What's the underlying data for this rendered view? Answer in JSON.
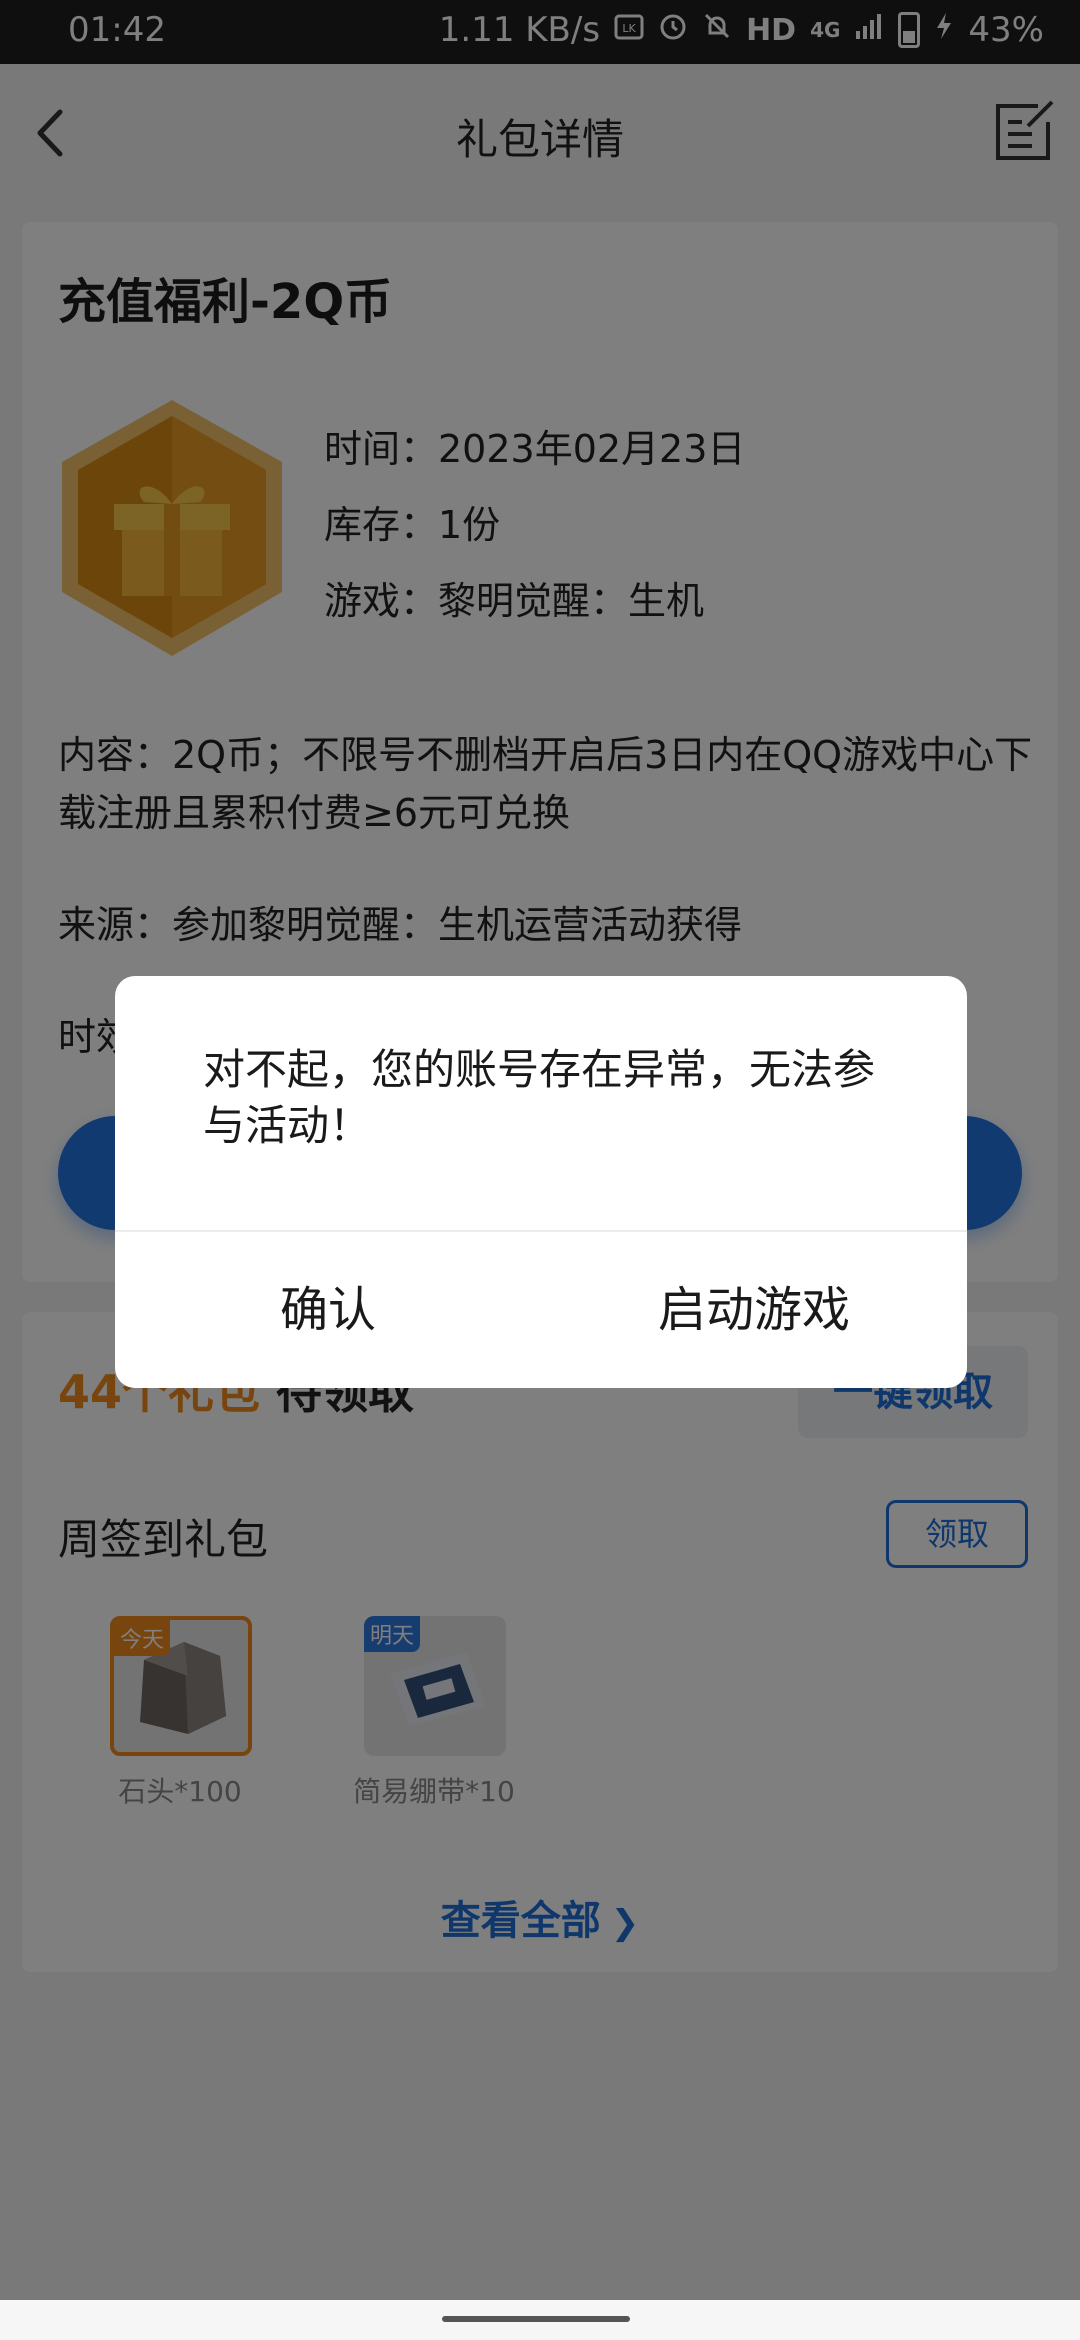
{
  "status_bar": {
    "time": "01:42",
    "net_speed": "1.11 KB/s",
    "hd": "HD",
    "network": "4G",
    "battery": "43%"
  },
  "header": {
    "title": "礼包详情"
  },
  "gift": {
    "title": "充值福利-2Q币",
    "time": "时间：2023年02月23日",
    "stock": "库存：1份",
    "game": "游戏：黎明觉醒：生机",
    "content": "内容：2Q币；不限号不删档开启后3日内在QQ游戏中心下载注册且累积付费≥6元可兑换",
    "source": "来源：参加黎明觉醒：生机运营活动获得",
    "valid_prefix": "时效"
  },
  "gifts_section": {
    "pending_count": "44个礼包",
    "pending_suffix": "待领取",
    "one_click_label": "一键领取",
    "weekly_title": "周签到礼包",
    "receive_label": "领取",
    "rewards": [
      {
        "tag": "今天",
        "name": "石头*100"
      },
      {
        "tag": "明天",
        "name": "简易绷带*10"
      }
    ],
    "view_all_label": "查看全部"
  },
  "dialog": {
    "message": "对不起，您的账号存在异常，无法参与活动！",
    "confirm_label": "确认",
    "launch_label": "启动游戏"
  },
  "colors": {
    "accent_blue": "#1e6fd8",
    "accent_orange": "#f08a1c",
    "overlay": "rgba(0,0,0,0.5)"
  }
}
